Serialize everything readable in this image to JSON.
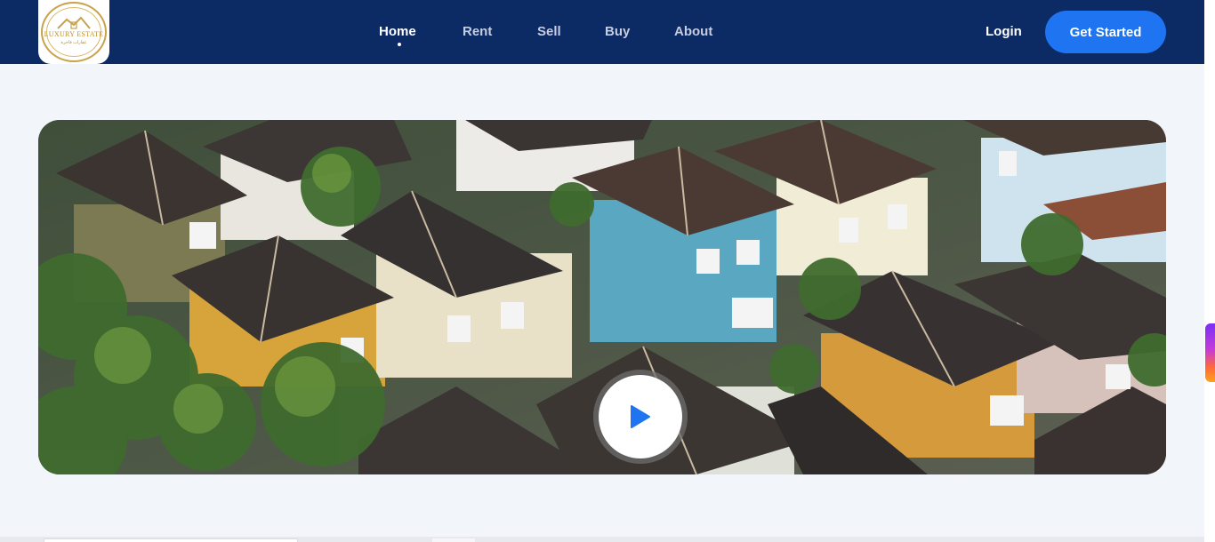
{
  "brand": {
    "logo_text": "LUXURY ESTATE",
    "logo_tagline": "عقارات فاخرة"
  },
  "nav": {
    "items": [
      {
        "label": "Home",
        "active": true
      },
      {
        "label": "Rent",
        "active": false
      },
      {
        "label": "Sell",
        "active": false
      },
      {
        "label": "Buy",
        "active": false
      },
      {
        "label": "About",
        "active": false
      }
    ],
    "login_label": "Login",
    "cta_label": "Get Started"
  },
  "hero": {
    "media": "aerial-photo-of-houses",
    "play_icon": "play-icon"
  },
  "colors": {
    "navbar": "#0c2a63",
    "accent": "#1f74f2",
    "background": "#f2f5fa",
    "logo_gold": "#c9a24a"
  }
}
